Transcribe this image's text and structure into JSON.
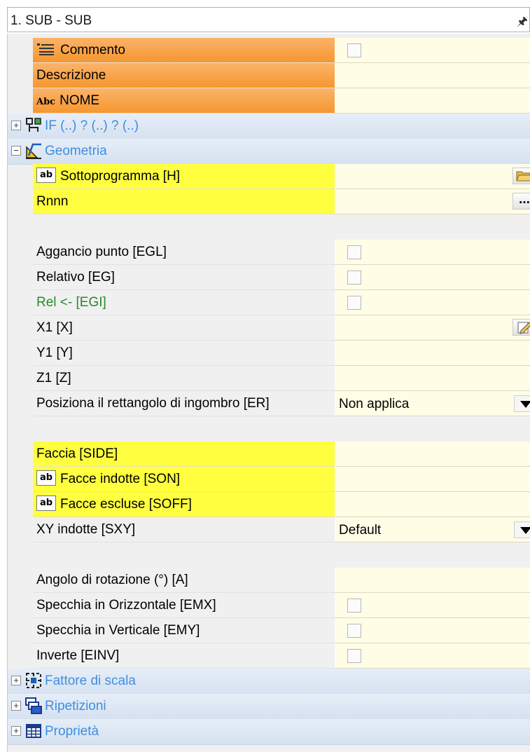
{
  "panel": {
    "title": "1. SUB - SUB",
    "pin_icon": "pin-icon"
  },
  "rows": {
    "commento": {
      "label": "Commento",
      "icon": "comment-lines-icon"
    },
    "descrizione": {
      "label": "Descrizione"
    },
    "nome": {
      "label": "NOME",
      "prefix": "Abc"
    },
    "if_section": {
      "label": "IF (..) ? (..) ? (..)",
      "icon": "condition-icon"
    },
    "geometria_section": {
      "label": "Geometria",
      "icon": "geometry-icon"
    },
    "sottoprogramma": {
      "label": "Sottoprogramma [H]",
      "prefix": "ab",
      "button_icon": "folder-open-icon"
    },
    "rnnn": {
      "label": "Rnnn",
      "button_label": "..."
    },
    "aggancio": {
      "label": "Aggancio punto [EGL]"
    },
    "relativo": {
      "label": "Relativo [EG]"
    },
    "rel": {
      "label": "Rel <- [EGI]"
    },
    "x1": {
      "label": "X1 [X]",
      "button_icon": "edit-pencil-icon"
    },
    "y1": {
      "label": "Y1 [Y]"
    },
    "z1": {
      "label": "Z1 [Z]"
    },
    "posiziona": {
      "label": "Posiziona il rettangolo di ingombro [ER]",
      "value": "Non applica"
    },
    "faccia": {
      "label": "Faccia [SIDE]"
    },
    "facce_indotte": {
      "label": "Facce indotte [SON]",
      "prefix": "ab"
    },
    "facce_escluse": {
      "label": "Facce escluse [SOFF]",
      "prefix": "ab"
    },
    "xy_indotte": {
      "label": "XY indotte [SXY]",
      "value": "Default"
    },
    "angolo": {
      "label": "Angolo di rotazione (°) [A]"
    },
    "specchia_o": {
      "label": "Specchia in Orizzontale [EMX]"
    },
    "specchia_v": {
      "label": "Specchia in Verticale [EMY]"
    },
    "inverte": {
      "label": "Inverte [EINV]"
    },
    "fattore_section": {
      "label": "Fattore di scala",
      "icon": "scale-icon"
    },
    "ripetizioni_section": {
      "label": "Ripetizioni",
      "icon": "repeat-icon"
    },
    "proprieta_section": {
      "label": "Proprietà",
      "icon": "properties-table-icon"
    }
  },
  "colors": {
    "orange": "#f5972f",
    "yellow": "#ffff3f",
    "value_bg": "#fffde6",
    "section_text": "#3f8ee0",
    "green_text": "#2a8a2a"
  }
}
